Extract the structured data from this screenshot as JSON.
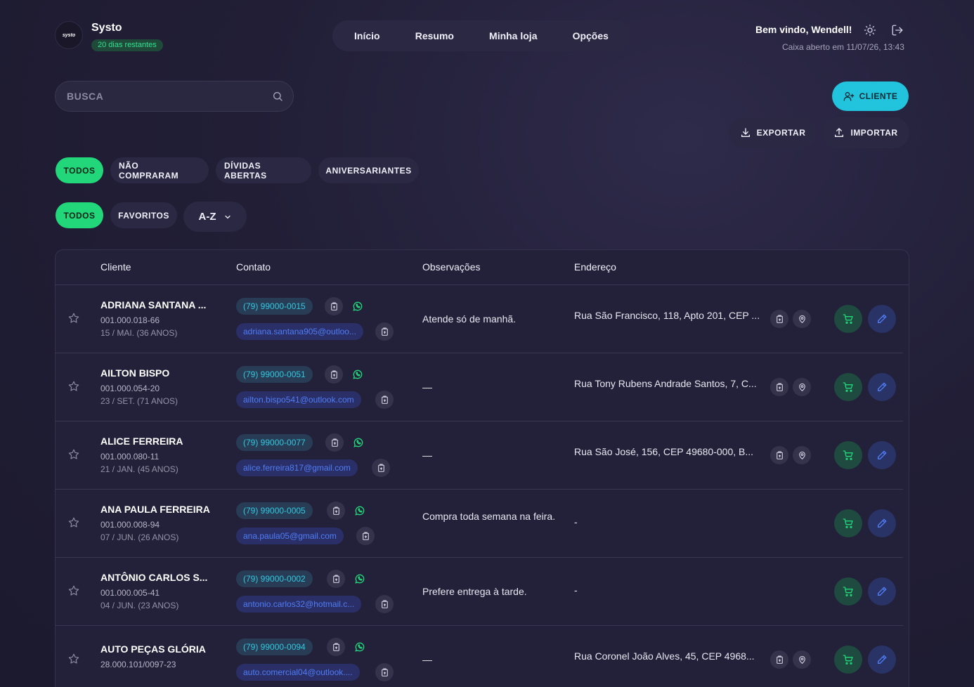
{
  "header": {
    "logo_text": "systo",
    "brand": "Systo",
    "trial": "20 dias restantes",
    "nav": [
      "Início",
      "Resumo",
      "Minha loja",
      "Opções"
    ],
    "welcome": "Bem vindo, Wendell!",
    "caixa": "Caixa aberto em 11/07/26, 13:43"
  },
  "search": {
    "placeholder": "BUSCA"
  },
  "buttons": {
    "cliente": "CLIENTE",
    "exportar": "EXPORTAR",
    "importar": "IMPORTAR"
  },
  "filters": {
    "status": [
      "TODOS",
      "NÃO COMPRARAM",
      "DÍVIDAS ABERTAS",
      "ANIVERSARIANTES"
    ],
    "group": [
      "TODOS",
      "FAVORITOS"
    ],
    "sort": "A-Z"
  },
  "table": {
    "headers": [
      "Cliente",
      "Contato",
      "Observações",
      "Endereço"
    ],
    "rows": [
      {
        "name": "ADRIANA SANTANA ...",
        "doc": "001.000.018-66",
        "bday": "15 / MAI. (36 ANOS)",
        "phone": "(79) 99000-0015",
        "email": "adriana.santana905@outloo...",
        "obs": "Atende só de manhã.",
        "addr": "Rua São Francisco, 118, Apto 201, CEP ..."
      },
      {
        "name": "AILTON BISPO",
        "doc": "001.000.054-20",
        "bday": "23 / SET. (71 ANOS)",
        "phone": "(79) 99000-0051",
        "email": "ailton.bispo541@outlook.com",
        "obs": "—",
        "addr": "Rua Tony Rubens Andrade Santos, 7, C..."
      },
      {
        "name": "ALICE FERREIRA",
        "doc": "001.000.080-11",
        "bday": "21 / JAN. (45 ANOS)",
        "phone": "(79) 99000-0077",
        "email": "alice.ferreira817@gmail.com",
        "obs": "—",
        "addr": "Rua São José, 156, CEP 49680-000, B..."
      },
      {
        "name": "ANA PAULA FERREIRA",
        "doc": "001.000.008-94",
        "bday": "07 / JUN. (26 ANOS)",
        "phone": "(79) 99000-0005",
        "email": "ana.paula05@gmail.com",
        "obs": "Compra toda semana na feira.",
        "addr": "-"
      },
      {
        "name": "ANTÔNIO CARLOS S...",
        "doc": "001.000.005-41",
        "bday": "04 / JUN. (23 ANOS)",
        "phone": "(79) 99000-0002",
        "email": "antonio.carlos32@hotmail.c...",
        "obs": "Prefere entrega à tarde.",
        "addr": "-"
      },
      {
        "name": "AUTO PEÇAS GLÓRIA",
        "doc": "28.000.101/0097-23",
        "bday": "",
        "phone": "(79) 99000-0094",
        "email": "auto.comercial04@outlook....",
        "obs": "—",
        "addr": "Rua Coronel João Alves, 45, CEP 4968..."
      }
    ]
  },
  "icons": [
    "logo",
    "sun-icon",
    "logout-icon",
    "search-icon",
    "user-plus-icon",
    "download-icon",
    "upload-icon",
    "chevron-down-icon",
    "star-icon",
    "copy-icon",
    "whatsapp-icon",
    "map-pin-icon",
    "cart-icon",
    "pencil-icon"
  ],
  "colors": {
    "accent_cyan": "#22c3dc",
    "accent_green": "#22d67a",
    "background": "#211e36",
    "phone_text": "#31c9e0",
    "email_text": "#4f7df5"
  }
}
